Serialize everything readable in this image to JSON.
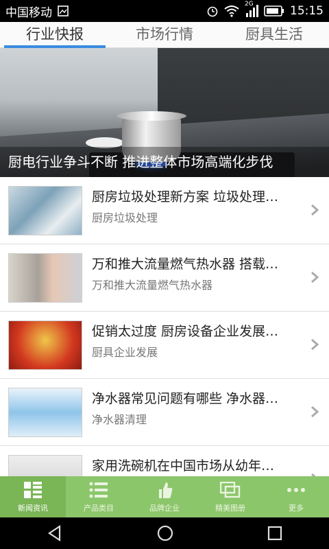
{
  "statusbar": {
    "carrier": "中国移动",
    "network_tag": "2G",
    "time": "15:15"
  },
  "tabs": [
    {
      "label": "行业快报",
      "active": true
    },
    {
      "label": "市场行情",
      "active": false
    },
    {
      "label": "厨具生活",
      "active": false
    }
  ],
  "hero": {
    "caption": "厨电行业争斗不断 推进整体市场高端化步伐"
  },
  "list": [
    {
      "title": "厨房垃圾处理新方案 垃圾处理…",
      "subtitle": "厨房垃圾处理"
    },
    {
      "title": "万和推大流量燃气热水器 搭载…",
      "subtitle": "万和推大流量燃气热水器"
    },
    {
      "title": "促销太过度 厨房设备企业发展…",
      "subtitle": "厨具企业发展"
    },
    {
      "title": "净水器常见问题有哪些 净水器…",
      "subtitle": "净水器清理"
    },
    {
      "title": "家用洗碗机在中国市场从幼年…",
      "subtitle": ""
    }
  ],
  "bottom_nav": [
    {
      "label": "新闻资讯",
      "icon": "grid-icon",
      "active": true
    },
    {
      "label": "产品类目",
      "icon": "list-icon",
      "active": false
    },
    {
      "label": "品牌企业",
      "icon": "thumbs-up-icon",
      "active": false
    },
    {
      "label": "精美图册",
      "icon": "gallery-icon",
      "active": false
    },
    {
      "label": "更多",
      "icon": "more-icon",
      "active": false
    }
  ],
  "colors": {
    "tab_indicator": "#3a8be0",
    "bottom_nav_bg": "#8cc66a",
    "bottom_nav_active": "#7ab556"
  }
}
